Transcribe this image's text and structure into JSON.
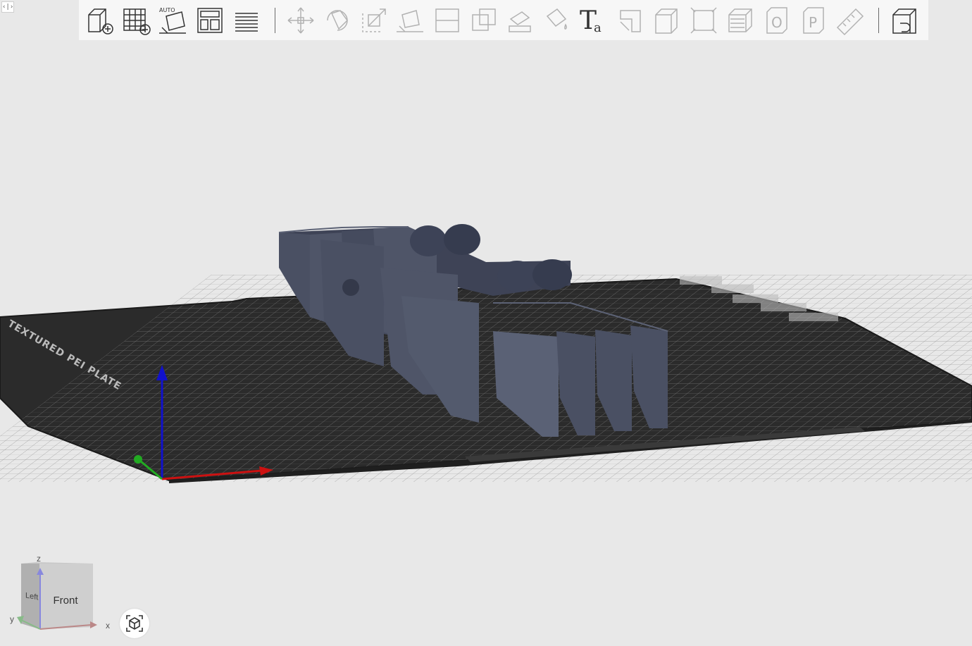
{
  "collapse_toggle": "‹|›",
  "toolbar": {
    "groups": [
      [
        {
          "name": "add-object-icon",
          "state": "enabled"
        },
        {
          "name": "add-plate-icon",
          "state": "enabled"
        },
        {
          "name": "auto-orient-icon",
          "state": "enabled",
          "text": "AUTO"
        },
        {
          "name": "arrange-icon",
          "state": "enabled"
        },
        {
          "name": "layers-icon",
          "state": "enabled"
        }
      ],
      [
        {
          "name": "move-icon",
          "state": "disabled"
        },
        {
          "name": "rotate-icon",
          "state": "disabled"
        },
        {
          "name": "scale-icon",
          "state": "disabled"
        },
        {
          "name": "lay-on-face-icon",
          "state": "disabled"
        },
        {
          "name": "cut-icon",
          "state": "disabled"
        },
        {
          "name": "boolean-icon",
          "state": "disabled"
        },
        {
          "name": "support-paint-icon",
          "state": "disabled"
        },
        {
          "name": "color-paint-icon",
          "state": "disabled"
        },
        {
          "name": "text-icon",
          "state": "enabled",
          "text": "Ta"
        },
        {
          "name": "seam-icon",
          "state": "disabled"
        },
        {
          "name": "fuzzy-skin-icon",
          "state": "disabled"
        },
        {
          "name": "measure-bbox-icon",
          "state": "disabled"
        },
        {
          "name": "variable-layer-icon",
          "state": "disabled"
        },
        {
          "name": "part-o-icon",
          "state": "disabled",
          "text": "O"
        },
        {
          "name": "part-p-icon",
          "state": "disabled",
          "text": "P"
        },
        {
          "name": "ruler-icon",
          "state": "disabled"
        }
      ],
      [
        {
          "name": "slice-plate-icon",
          "state": "enabled"
        }
      ]
    ]
  },
  "viewport": {
    "bed_label": "TEXTURED PEI PLATE",
    "axes": {
      "x_color": "#cc1111",
      "y_color": "#22aa22",
      "z_color": "#1111cc"
    },
    "model_color": "#4a5063"
  },
  "view_cube": {
    "front": "Front",
    "left": "Left",
    "z": "z",
    "y": "y",
    "x": "x"
  },
  "reset_view": "reset-view-icon"
}
